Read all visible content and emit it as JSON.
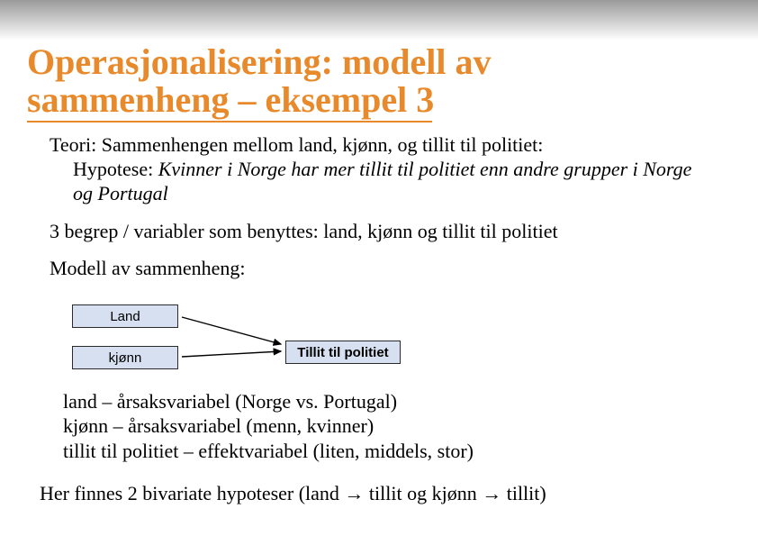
{
  "title": {
    "line1": "Operasjonalisering: modell av",
    "line2": "sammenheng – eksempel 3"
  },
  "theory": {
    "line1": "Teori: Sammenhengen mellom land, kjønn, og tillit til politiet:",
    "hypo_lead": "Hypotese: ",
    "hypo_italic": "Kvinner i Norge har mer tillit til politiet enn andre grupper i Norge og Portugal"
  },
  "variables_line": "3 begrep / variabler som benyttes: land, kjønn og tillit til politiet",
  "model_label": "Modell av sammenheng:",
  "boxes": {
    "land": "Land",
    "kjonn": "kjønn",
    "tillit": "Tillit til politiet"
  },
  "explain": {
    "l1": "land – årsaksvariabel (Norge vs. Portugal)",
    "l2": "kjønn – årsaksvariabel (menn, kvinner)",
    "l3": "tillit til politiet – effektvariabel (liten, middels, stor)"
  },
  "final_line": "Her finnes 2 bivariate hypoteser (land → tillit  og  kjønn → tillit)"
}
